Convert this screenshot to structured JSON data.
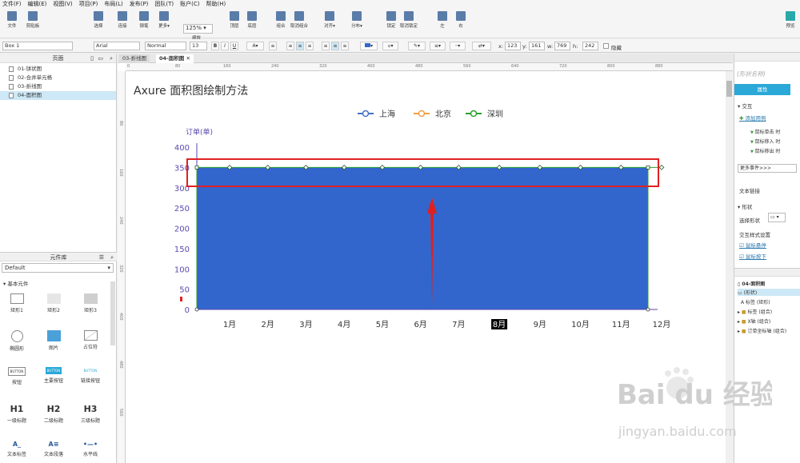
{
  "menubar": [
    "文件(F)",
    "编辑(E)",
    "视图(V)",
    "项目(P)",
    "布局(L)",
    "发布(P)",
    "团队(T)",
    "账户(C)",
    "帮助(H)"
  ],
  "toolbar": {
    "buttons": [
      "文件",
      "剪贴板",
      "选择",
      "连接",
      "钢笔",
      "更多▾",
      "缩放",
      "顶层",
      "底层",
      "组合",
      "取消组合",
      "对齐▾",
      "分布▾",
      "锁定",
      "取消锁定",
      "左",
      "右",
      "预览"
    ],
    "zoom": "125%"
  },
  "format": {
    "shape_name": "Box 1",
    "font": "Arial",
    "weight": "Normal",
    "size": "13",
    "x_label": "x:",
    "x": "123",
    "y_label": "y:",
    "y": "161",
    "w_label": "w:",
    "w": "769",
    "h_label": "h:",
    "h": "242",
    "hidden": "隐藏"
  },
  "pages": {
    "title": "页面",
    "items": [
      "01-饼状图",
      "02-合并单元格",
      "03-折线图",
      "04-面积图"
    ],
    "active": 3
  },
  "library": {
    "title": "元件库",
    "selected": "Default",
    "category": "基本元件",
    "widgets": [
      "矩形1",
      "矩形2",
      "矩形3",
      "椭圆形",
      "图片",
      "占位符",
      "按钮",
      "主要按钮",
      "链接按钮",
      "一级标题",
      "二级标题",
      "三级标题",
      "文本标签",
      "文本段落",
      "水平线"
    ],
    "widget_glyphs": [
      "",
      "",
      "",
      "",
      "",
      "",
      "BUTTON",
      "BUTTON",
      "BUTTON",
      "H1",
      "H2",
      "H3",
      "A_",
      "A≡",
      "•—•"
    ]
  },
  "canvas": {
    "tabs": [
      "03-折线图",
      "04-面积图"
    ],
    "ruler_h": [
      "0",
      "80",
      "160",
      "240",
      "320",
      "400",
      "480",
      "560",
      "640",
      "720",
      "800",
      "880"
    ],
    "ruler_v": [
      "80",
      "160",
      "240",
      "320",
      "400",
      "480",
      "560"
    ]
  },
  "right": {
    "shape_name_placeholder": "(形状名称)",
    "tab": "属性",
    "interaction": "交互",
    "add_case": "添加用例",
    "events": [
      "鼠标单击 时",
      "鼠标移入 时",
      "鼠标移出 时"
    ],
    "more_events": "更多事件>>>",
    "text_link": "文本链接",
    "shape_section": "形状",
    "select_shape": "选择形状",
    "style_settings": "交互样式设置",
    "hover": "鼠标悬停",
    "mouse_down": "鼠标按下",
    "outline": [
      "04-面积图",
      "(形状)",
      "标签 (矩形)",
      "标签 (组合)",
      "X轴 (组合)",
      "订单坐标轴 (组合)"
    ]
  },
  "colors": {
    "area_fill": "#3366cc",
    "line_shanghai": "#4472c4",
    "line_beijing": "#f0a040",
    "line_shenzhen": "#2ca02c",
    "highlight_box": "#e02020",
    "arrow": "#e02020"
  },
  "chart_data": {
    "type": "area",
    "title": "Axure 面积图绘制方法",
    "ylabel": "订单(单)",
    "categories": [
      "1月",
      "2月",
      "3月",
      "4月",
      "5月",
      "6月",
      "7月",
      "8月",
      "9月",
      "10月",
      "11月",
      "12月"
    ],
    "series": [
      {
        "name": "上海",
        "values": [
          350,
          350,
          350,
          350,
          350,
          350,
          350,
          350,
          350,
          350,
          350,
          350
        ]
      },
      {
        "name": "北京",
        "values": []
      },
      {
        "name": "深圳",
        "values": []
      }
    ],
    "yticks": [
      0,
      50,
      100,
      150,
      200,
      250,
      300,
      350,
      400
    ],
    "ylim": [
      0,
      400
    ],
    "highlight_category": "8月",
    "legend_position": "top-center"
  },
  "watermark": {
    "brand": "Bai du 经验",
    "url": "jingyan.baidu.com"
  }
}
